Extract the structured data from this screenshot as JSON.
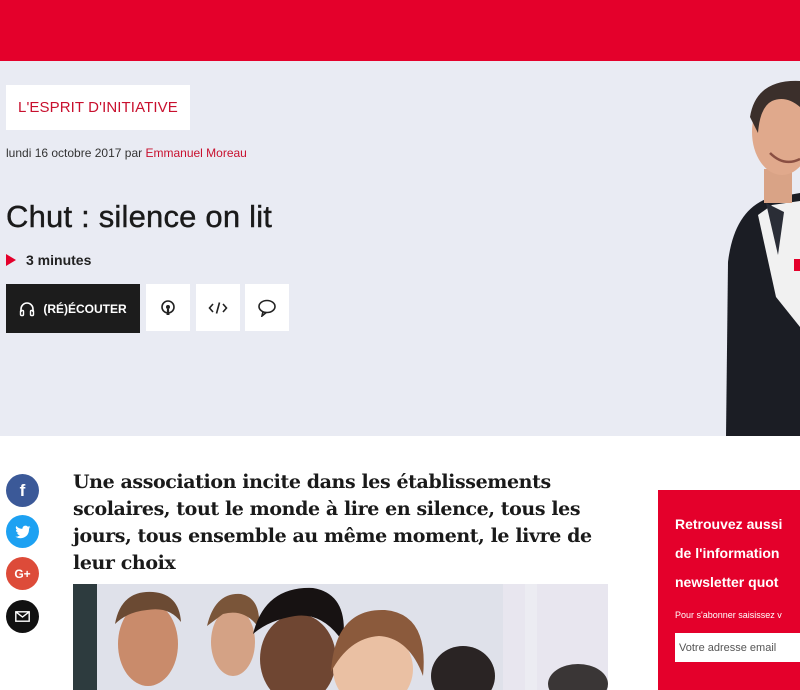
{
  "header": {
    "brand_color": "#e4002b"
  },
  "hero": {
    "show_name": "L'ESPRIT D'INITIATIVE",
    "date": "lundi 16 octobre 2017",
    "by": "par",
    "author": "Emmanuel Moreau",
    "title": "Chut : silence on lit",
    "duration": "3 minutes",
    "listen_label": "(RÉ)ÉCOUTER",
    "actions": [
      {
        "icon": "podcast-icon"
      },
      {
        "icon": "embed-code-icon"
      },
      {
        "icon": "comment-icon"
      }
    ]
  },
  "share": [
    {
      "icon": "facebook-icon",
      "glyph": "f",
      "color": "#3b5998"
    },
    {
      "icon": "twitter-icon",
      "color": "#1da1f2"
    },
    {
      "icon": "google-plus-icon",
      "glyph": "G+",
      "color": "#dd4b39"
    },
    {
      "icon": "email-icon",
      "color": "#111111"
    }
  ],
  "article": {
    "chapo": "Une association incite dans les établissements scolaires, tout le monde à lire en silence, tous les jours, tous ensemble au même moment, le livre de leur choix"
  },
  "newsletter": {
    "title": "Retrouvez aussi\nde l'information\nnewsletter quot",
    "hint": "Pour s'abonner saisissez v",
    "placeholder": "Votre adresse email"
  }
}
